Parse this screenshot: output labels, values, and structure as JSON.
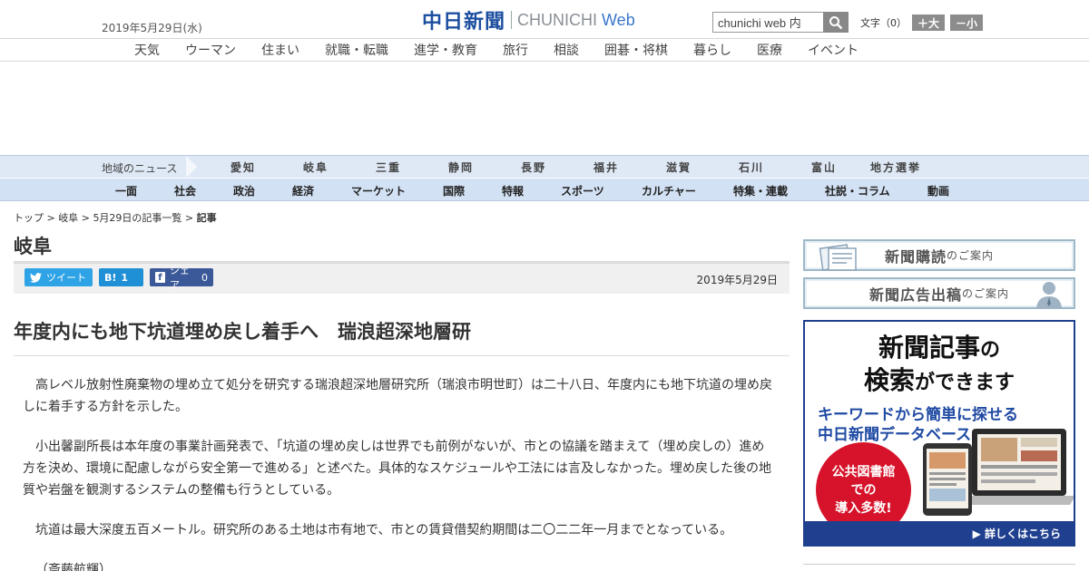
{
  "header": {
    "date": "2019年5月29日(水)",
    "logo_jp": "中日新聞",
    "logo_en": "CHUNICHI",
    "logo_web": "Web",
    "search_value": "chunichi web 内",
    "text_size_label": "文字（0）",
    "text_bigger": "＋大",
    "text_smaller": "－小"
  },
  "category_nav": [
    "天気",
    "ウーマン",
    "住まい",
    "就職・転職",
    "進学・教育",
    "旅行",
    "相談",
    "囲碁・将棋",
    "暮らし",
    "医療",
    "イベント"
  ],
  "region_nav": {
    "label": "地域のニュース",
    "items": [
      "愛知",
      "岐阜",
      "三重",
      "静岡",
      "長野",
      "福井",
      "滋賀",
      "石川",
      "富山",
      "地方選挙"
    ]
  },
  "section_nav": [
    "一面",
    "社会",
    "政治",
    "経済",
    "マーケット",
    "国際",
    "特報",
    "スポーツ",
    "カルチャー",
    "特集・連載",
    "社説・コラム",
    "動画"
  ],
  "breadcrumb": {
    "items": [
      "トップ",
      "岐阜",
      "5月29日の記事一覧"
    ],
    "current": "記事",
    "separator": " > "
  },
  "page_title": "岐阜",
  "share": {
    "tweet": "ツイート",
    "hatena_icon": "B!",
    "hatena_count": "1",
    "facebook_icon": "f",
    "facebook": "シェア",
    "facebook_count": "0",
    "date": "2019年5月29日"
  },
  "article": {
    "headline": "年度内にも地下坑道埋め戻し着手へ　瑞浪超深地層研",
    "paragraphs": [
      "高レベル放射性廃棄物の埋め立て処分を研究する瑞浪超深地層研究所（瑞浪市明世町）は二十八日、年度内にも地下坑道の埋め戻しに着手する方針を示した。",
      "小出馨副所長は本年度の事業計画発表で、「坑道の埋め戻しは世界でも前例がないが、市との協議を踏まえて（埋め戻しの）進め方を決め、環境に配慮しながら安全第一で進める」と述べた。具体的なスケジュールや工法には言及しなかった。埋め戻した後の地質や岩盤を観測するシステムの整備も行うとしている。",
      "坑道は最大深度五百メートル。研究所のある土地は市有地で、市との賃貸借契約期間は二〇二二年一月までとなっている。",
      "（斎藤航輝）"
    ]
  },
  "sidebar": {
    "subscribe_main": "新聞購読",
    "subscribe_sub": "のご案内",
    "ad_main": "新聞広告出稿",
    "ad_sub": "のご案内",
    "promo": {
      "line1_main": "新聞記事",
      "line1_sub": "の",
      "line2_main": "検索",
      "line2_sub": "ができます",
      "line3": "キーワードから簡単に探せる",
      "line4": "中日新聞データベース",
      "circle1": "公共図書館",
      "circle2": "での",
      "circle3": "導入多数!",
      "footer": "▶ 詳しくはこちら"
    }
  },
  "colors": {
    "brand_blue": "#1d4fa0",
    "nav_light": "#dfe9f6",
    "nav_section": "#d2e1f3",
    "twitter": "#2ea3e6",
    "hatena": "#1f8fd6",
    "facebook": "#3b5998",
    "promo_red": "#d6132a"
  }
}
